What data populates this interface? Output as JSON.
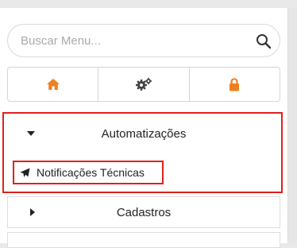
{
  "search": {
    "placeholder": "Buscar Menu...",
    "value": ""
  },
  "toolbar": {
    "items": [
      {
        "icon": "home-icon",
        "color": "#f07f1e"
      },
      {
        "icon": "gears-icon",
        "color": "#444444"
      },
      {
        "icon": "lock-icon",
        "color": "#f07f1e"
      }
    ]
  },
  "menu": {
    "expanded_group": {
      "label": "Automatizações",
      "expanded": true,
      "items": [
        {
          "label": "Notificações Técnicas",
          "icon": "paper-plane-icon"
        }
      ]
    },
    "collapsed_groups": [
      {
        "label": "Cadastros",
        "expanded": false
      }
    ]
  },
  "colors": {
    "accent": "#f07f1e",
    "highlight": "#e0201f"
  }
}
